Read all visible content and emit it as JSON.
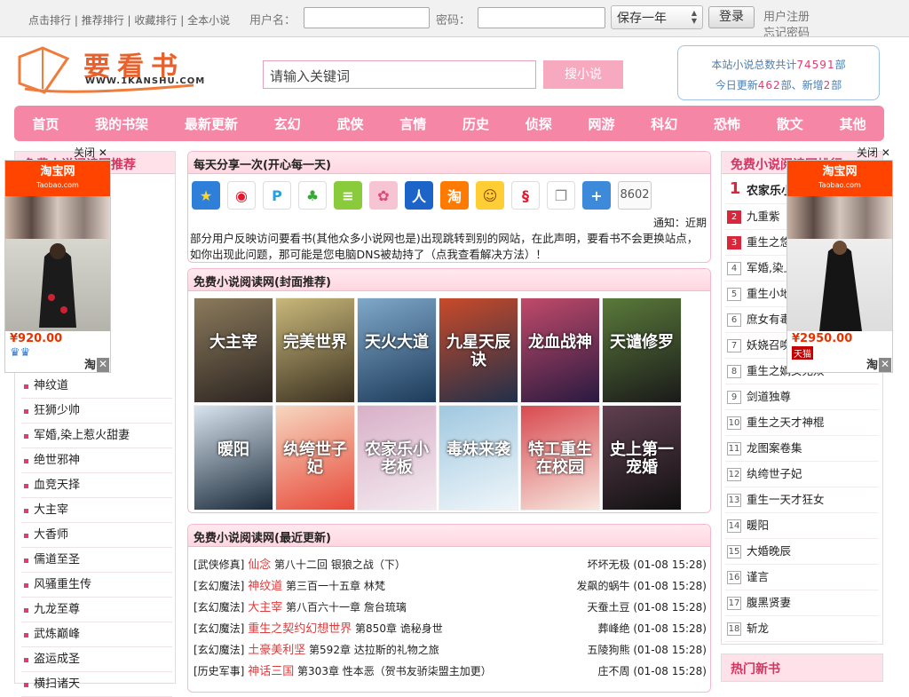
{
  "topbar": {
    "links": [
      "点击排行",
      "推荐排行",
      "收藏排行",
      "全本小说"
    ],
    "username_label": "用户名：",
    "password_label": "密码：",
    "remember_option": "保存一年",
    "login_label": "登录",
    "register_label": "用户注册",
    "forgot_label": "忘记密码"
  },
  "logo": {
    "name": "要看书",
    "url_text": "WWW.1KANSHU.COM"
  },
  "search": {
    "placeholder": "请输入关键词",
    "button": "搜小说"
  },
  "stats": {
    "line1_prefix": "本站小说总数共计",
    "total": "74591",
    "line1_suffix": "部",
    "line2_prefix": "今日更新",
    "updated": "462",
    "line2_mid": "部、新增",
    "added": "2",
    "line2_suffix": "部"
  },
  "nav": [
    "首页",
    "我的书架",
    "最新更新",
    "玄幻",
    "武侠",
    "言情",
    "历史",
    "侦探",
    "网游",
    "科幻",
    "恐怖",
    "散文",
    "其他"
  ],
  "left": {
    "title": "免费小说阅读网推荐",
    "items": [
      "神纹道",
      "狂狮少帅",
      "军婚,染上惹火甜妻",
      "绝世邪神",
      "血竞天择",
      "大主宰",
      "大香师",
      "儒道至圣",
      "风骚重生传",
      "九龙至尊",
      "武炼巅峰",
      "盗运成圣",
      "横扫诸天"
    ]
  },
  "share": {
    "title": "每天分享一次(开心每一天)",
    "count": "8602",
    "notice": "通知：近期",
    "text": "部分用户反映访问要看书(其他众多小说网也是)出现跳转到别的网站，在此声明，要看书不会更换站点，如你出现此问题，那可能是您电脑DNS被劫持了（点我查看解决方法）！"
  },
  "covers": {
    "title": "免费小说阅读网(封面推荐)",
    "books": [
      "大主宰",
      "完美世界",
      "",
      "天火大道",
      "九星天辰诀",
      "龙血战神",
      "天谴修罗",
      "暖阳",
      "纨绔世子妃",
      "农家乐小老板",
      "毒妹来袭",
      "特工重生在校园",
      "史上第一宠婚"
    ]
  },
  "updates": {
    "title": "免费小说阅读网(最近更新)",
    "rows": [
      {
        "cat": "[武侠修真]",
        "book": "仙念",
        "chapter": "第八十二回 银狼之战（下）",
        "author": "坏坏无极",
        "time": "(01-08 15:28)"
      },
      {
        "cat": "[玄幻魔法]",
        "book": "神纹道",
        "chapter": "第三百一十五章 林梵",
        "author": "发飙的蜗牛",
        "time": "(01-08 15:28)"
      },
      {
        "cat": "[玄幻魔法]",
        "book": "大主宰",
        "chapter": "第八百六十一章 詹台琉璃",
        "author": "天蚕土豆",
        "time": "(01-08 15:28)"
      },
      {
        "cat": "[玄幻魔法]",
        "book": "重生之契约幻想世界",
        "chapter": "第850章 诡秘身世",
        "author": "葬峰绝",
        "time": "(01-08 15:28)"
      },
      {
        "cat": "[玄幻魔法]",
        "book": "土豪美利坚",
        "chapter": "第592章 达拉斯的礼物之旅",
        "author": "五陵狗熊",
        "time": "(01-08 15:28)"
      },
      {
        "cat": "[历史军事]",
        "book": "神话三国",
        "chapter": "第303章 性本恶（贺书友骄柒盟主加更）",
        "author": "庄不周",
        "time": "(01-08 15:28)"
      }
    ]
  },
  "right": {
    "title": "免费小说阅读网排行",
    "items": [
      "农家乐小老板",
      "九重紫",
      "重生之悠闲小日子",
      "军婚,染上惹火甜妻",
      "重生小地主",
      "庶女有毒",
      "妖娆召唤师",
      "重生之嫡女无双",
      "剑道独尊",
      "重生之天才神棍",
      "龙图案卷集",
      "纨绔世子妃",
      "重生一天才狂女",
      "暖阳",
      "大婚晚辰",
      "谨言",
      "腹黑贤妻",
      "斩龙"
    ],
    "hot_title": "热门新书"
  },
  "ads": {
    "brand": "淘宝网",
    "brand_en": "Taobao.com",
    "close": "关闭",
    "left_price": "¥920.00",
    "right_price": "¥2950.00",
    "tmall": "天猫",
    "tao": "淘"
  }
}
